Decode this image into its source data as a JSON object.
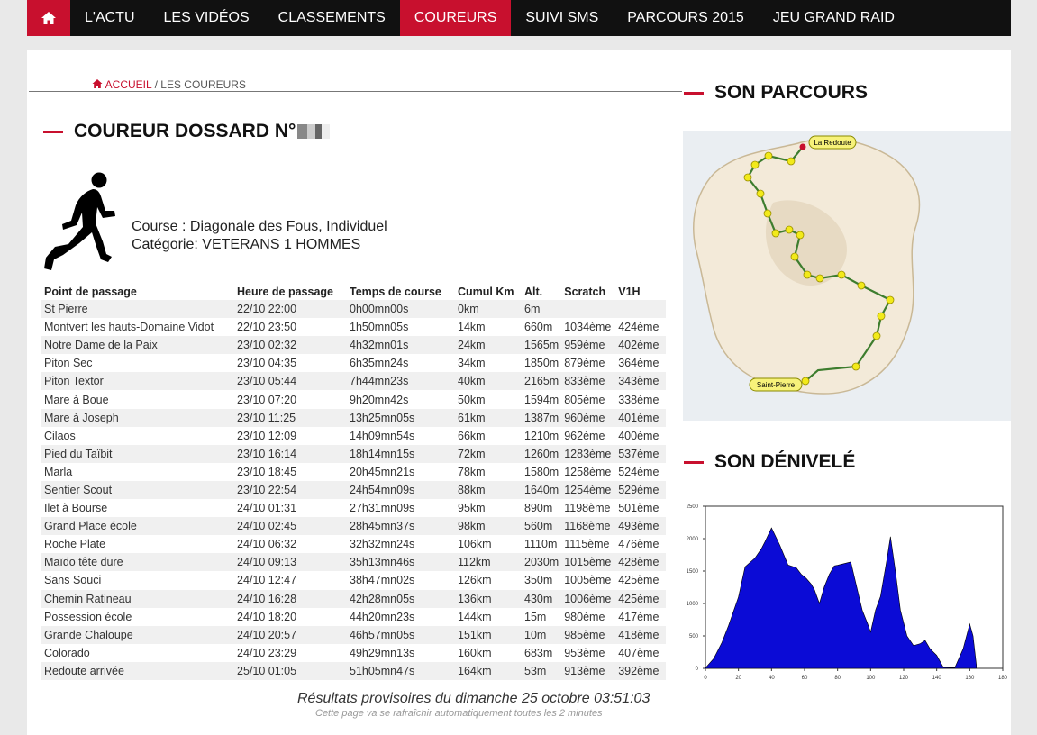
{
  "nav": {
    "items": [
      {
        "label": "L'ACTU",
        "active": false
      },
      {
        "label": "LES VIDÉOS",
        "active": false
      },
      {
        "label": "CLASSEMENTS",
        "active": false
      },
      {
        "label": "COUREURS",
        "active": true
      },
      {
        "label": "SUIVI SMS",
        "active": false
      },
      {
        "label": "PARCOURS 2015",
        "active": false
      },
      {
        "label": "JEU GRAND RAID",
        "active": false
      }
    ]
  },
  "breadcrumb": {
    "home": "ACCUEIL",
    "sep": "/",
    "current": "LES COUREURS"
  },
  "runner": {
    "title": "COUREUR DOSSARD N°",
    "course": "Course : Diagonale des Fous, Individuel",
    "category": "Catégorie: VETERANS 1 HOMMES"
  },
  "table": {
    "headers": [
      "Point de passage",
      "Heure de passage",
      "Temps de course",
      "Cumul Km",
      "Alt.",
      "Scratch",
      "V1H"
    ],
    "rows": [
      [
        "St Pierre",
        "22/10 22:00",
        "0h00mn00s",
        "0km",
        "6m",
        "",
        ""
      ],
      [
        "Montvert les hauts-Domaine Vidot",
        "22/10 23:50",
        "1h50mn05s",
        "14km",
        "660m",
        "1034ème",
        "424ème"
      ],
      [
        "Notre Dame de la Paix",
        "23/10 02:32",
        "4h32mn01s",
        "24km",
        "1565m",
        "959ème",
        "402ème"
      ],
      [
        "Piton Sec",
        "23/10 04:35",
        "6h35mn24s",
        "34km",
        "1850m",
        "879ème",
        "364ème"
      ],
      [
        "Piton Textor",
        "23/10 05:44",
        "7h44mn23s",
        "40km",
        "2165m",
        "833ème",
        "343ème"
      ],
      [
        "Mare à Boue",
        "23/10 07:20",
        "9h20mn42s",
        "50km",
        "1594m",
        "805ème",
        "338ème"
      ],
      [
        "Mare à Joseph",
        "23/10 11:25",
        "13h25mn05s",
        "61km",
        "1387m",
        "960ème",
        "401ème"
      ],
      [
        "Cilaos",
        "23/10 12:09",
        "14h09mn54s",
        "66km",
        "1210m",
        "962ème",
        "400ème"
      ],
      [
        "Pied du Taïbit",
        "23/10 16:14",
        "18h14mn15s",
        "72km",
        "1260m",
        "1283ème",
        "537ème"
      ],
      [
        "Marla",
        "23/10 18:45",
        "20h45mn21s",
        "78km",
        "1580m",
        "1258ème",
        "524ème"
      ],
      [
        "Sentier Scout",
        "23/10 22:54",
        "24h54mn09s",
        "88km",
        "1640m",
        "1254ème",
        "529ème"
      ],
      [
        "Ilet à Bourse",
        "24/10 01:31",
        "27h31mn09s",
        "95km",
        "890m",
        "1198ème",
        "501ème"
      ],
      [
        "Grand Place école",
        "24/10 02:45",
        "28h45mn37s",
        "98km",
        "560m",
        "1168ème",
        "493ème"
      ],
      [
        "Roche Plate",
        "24/10 06:32",
        "32h32mn24s",
        "106km",
        "1110m",
        "1115ème",
        "476ème"
      ],
      [
        "Maïdo tête dure",
        "24/10 09:13",
        "35h13mn46s",
        "112km",
        "2030m",
        "1015ème",
        "428ème"
      ],
      [
        "Sans Souci",
        "24/10 12:47",
        "38h47mn02s",
        "126km",
        "350m",
        "1005ème",
        "425ème"
      ],
      [
        "Chemin Ratineau",
        "24/10 16:28",
        "42h28mn05s",
        "136km",
        "430m",
        "1006ème",
        "425ème"
      ],
      [
        "Possession école",
        "24/10 18:20",
        "44h20mn23s",
        "144km",
        "15m",
        "980ème",
        "417ème"
      ],
      [
        "Grande Chaloupe",
        "24/10 20:57",
        "46h57mn05s",
        "151km",
        "10m",
        "985ème",
        "418ème"
      ],
      [
        "Colorado",
        "24/10 23:29",
        "49h29mn13s",
        "160km",
        "683m",
        "953ème",
        "407ème"
      ],
      [
        "Redoute arrivée",
        "25/10 01:05",
        "51h05mn47s",
        "164km",
        "53m",
        "913ème",
        "392ème"
      ]
    ]
  },
  "footer": {
    "results": "Résultats provisoires du dimanche 25 octobre 03:51:03",
    "refresh": "Cette page va se rafraîchir automatiquement toutes les 2 minutes"
  },
  "sections": {
    "parcours": "SON PARCOURS",
    "denivele": "SON DÉNIVELÉ"
  },
  "map": {
    "start_label": "Saint-Pierre",
    "end_label": "La Redoute",
    "route_color": "#3d7d2e",
    "marker_color": "#f2ea1a"
  },
  "chart_data": {
    "type": "area",
    "x": [
      0,
      5,
      10,
      14,
      20,
      24,
      30,
      34,
      36,
      40,
      45,
      50,
      55,
      58,
      61,
      64,
      66,
      69,
      72,
      75,
      78,
      80,
      88,
      93,
      95,
      98,
      100,
      103,
      106,
      110,
      112,
      115,
      118,
      122,
      126,
      130,
      133,
      136,
      140,
      144,
      148,
      151,
      156,
      160,
      162,
      164
    ],
    "y": [
      6,
      150,
      400,
      660,
      1100,
      1565,
      1700,
      1850,
      1950,
      2165,
      1900,
      1594,
      1550,
      1450,
      1387,
      1300,
      1210,
      1000,
      1260,
      1450,
      1580,
      1590,
      1640,
      1100,
      890,
      700,
      560,
      900,
      1110,
      1700,
      2030,
      1500,
      900,
      500,
      350,
      380,
      430,
      300,
      200,
      15,
      10,
      10,
      300,
      683,
      500,
      53
    ],
    "xlim": [
      0,
      180
    ],
    "ylim": [
      0,
      2500
    ],
    "x_ticks": [
      0,
      20,
      40,
      60,
      80,
      100,
      120,
      140,
      160,
      180
    ],
    "y_ticks": [
      0,
      500,
      1000,
      1500,
      2000,
      2500
    ],
    "fill_color": "#0b0bd6",
    "grid": false
  }
}
